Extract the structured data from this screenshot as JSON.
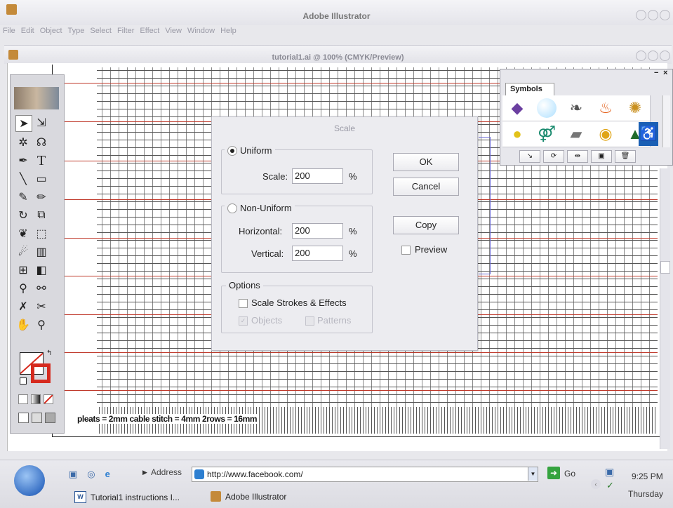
{
  "app": {
    "title": "Adobe Illustrator"
  },
  "menu": [
    "File",
    "Edit",
    "Object",
    "Type",
    "Select",
    "Filter",
    "Effect",
    "View",
    "Window",
    "Help"
  ],
  "document": {
    "title": "tutorial1.ai @ 100% (CMYK/Preview)"
  },
  "artboard": {
    "legend": "pleats = 2mm  cable stitch = 4mm  2rows = 16mm"
  },
  "symbols_panel": {
    "tab": "Symbols",
    "close": "×",
    "collapse": "−"
  },
  "dialog": {
    "title": "Scale",
    "uniform": {
      "label": "Uniform",
      "scale_label": "Scale:",
      "scale_value": "200",
      "unit": "%"
    },
    "non_uniform": {
      "label": "Non-Uniform",
      "horizontal_label": "Horizontal:",
      "horizontal_value": "200",
      "vertical_label": "Vertical:",
      "vertical_value": "200",
      "unit": "%"
    },
    "options": {
      "label": "Options",
      "scale_strokes": "Scale Strokes & Effects",
      "objects": "Objects",
      "patterns": "Patterns"
    },
    "buttons": {
      "ok": "OK",
      "cancel": "Cancel",
      "copy": "Copy"
    },
    "preview": "Preview"
  },
  "taskbar": {
    "address_label": "Address",
    "url": "http://www.facebook.com/",
    "go": "Go",
    "time": "9:25 PM",
    "day": "Thursday",
    "tasks": [
      "Tutorial1 instructions I...",
      "Adobe Illustrator"
    ]
  },
  "colors": {
    "accent_red": "#c0392b",
    "dialog_bg": "#ececf0",
    "toolbar_bg": "#d9d9de"
  }
}
